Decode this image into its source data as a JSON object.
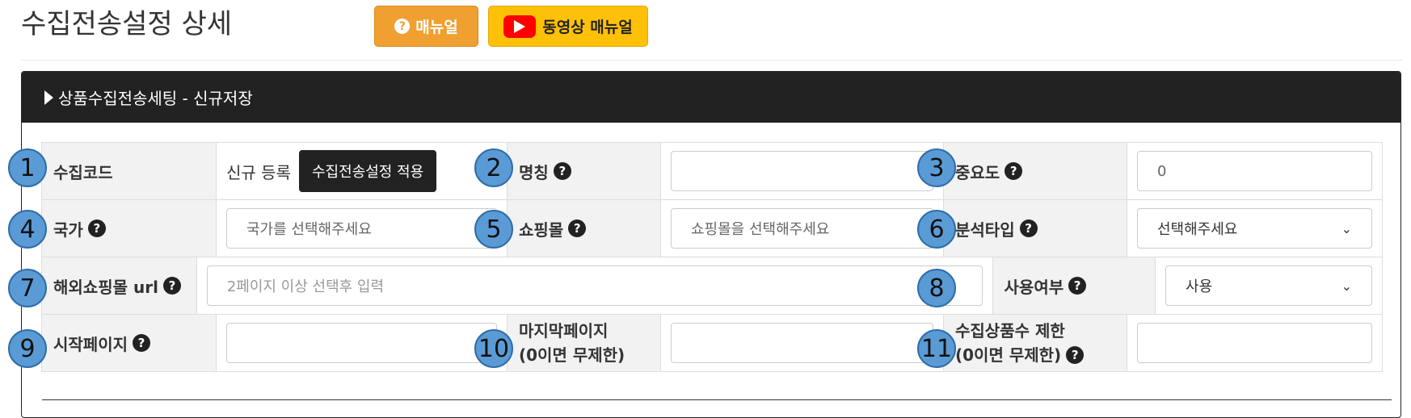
{
  "page": {
    "title": "수집전송설정 상세",
    "manual_label": "매뉴얼",
    "video_manual_label": "동영상 매뉴얼"
  },
  "panel": {
    "header": "상품수집전송세팅 - 신규저장"
  },
  "form": {
    "collect_code_label": "수집코드",
    "collect_code_value": "신규 등록",
    "apply_button": "수집전송설정 적용",
    "name_label": "명칭",
    "name_value": "",
    "importance_label": "중요도",
    "importance_value": "0",
    "country_label": "국가",
    "country_placeholder": "국가를 선택해주세요",
    "mall_label": "쇼핑몰",
    "mall_placeholder": "쇼핑몰을 선택해주세요",
    "analysis_label": "분석타입",
    "analysis_value": "선택해주세요",
    "overseas_url_label": "해외쇼핑몰 url",
    "overseas_url_placeholder": "2페이지 이상 선택후 입력",
    "use_label": "사용여부",
    "use_value": "사용",
    "start_page_label": "시작페이지",
    "start_page_value": "",
    "last_page_label_1": "마지막페이지",
    "last_page_label_2": "(0이면 무제한)",
    "last_page_value": "",
    "limit_label_1": "수집상품수 제한",
    "limit_label_2": "(0이면 무제한)",
    "limit_value": ""
  },
  "badges": [
    "1",
    "2",
    "3",
    "4",
    "5",
    "6",
    "7",
    "8",
    "9",
    "10",
    "11"
  ],
  "colors": {
    "manual_btn": "#f0a030",
    "video_btn": "#ffc107",
    "header_bg": "#222222",
    "badge": "#5b9bd5"
  },
  "icons": {
    "help": "question-circle-icon",
    "play": "youtube-play-icon",
    "caret": "caret-right-icon",
    "chevron": "chevron-down-icon"
  }
}
